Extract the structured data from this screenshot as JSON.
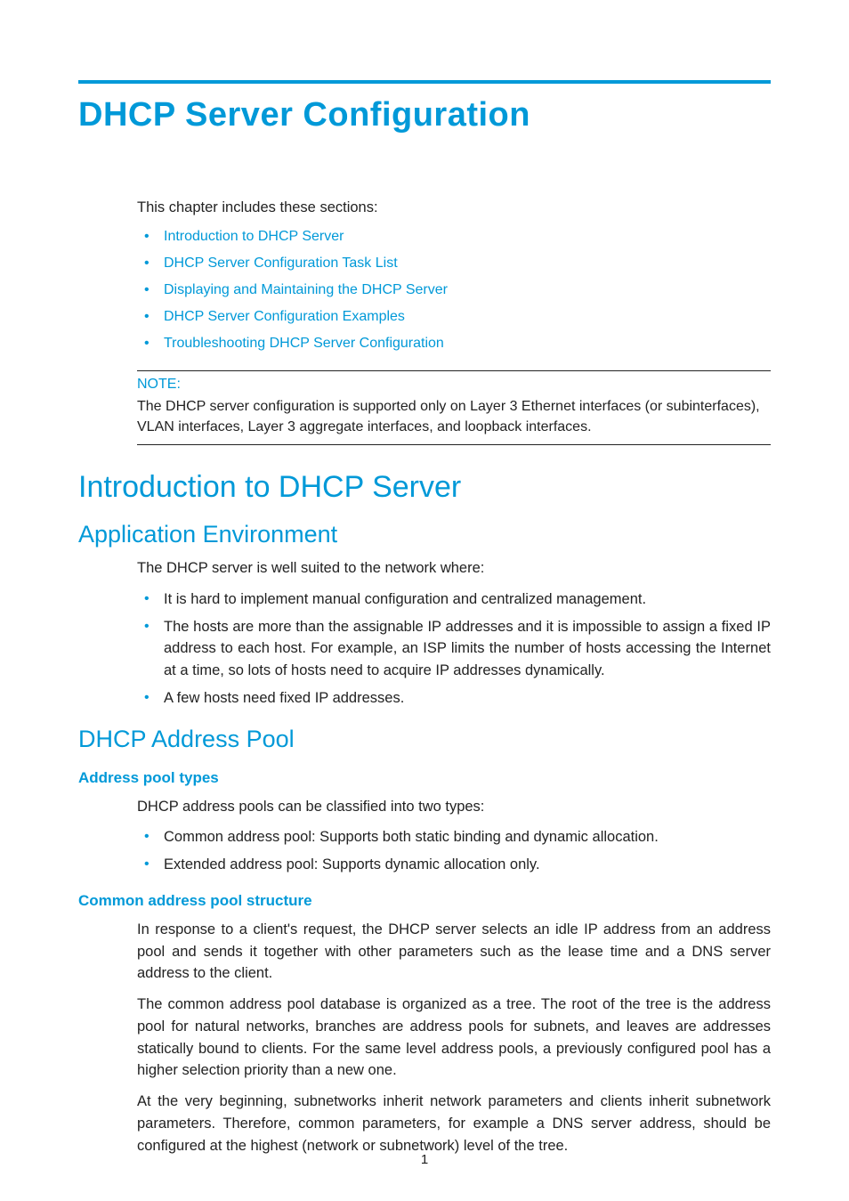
{
  "title": "DHCP Server Configuration",
  "intro": "This chapter includes these sections:",
  "toc": [
    "Introduction to DHCP Server",
    "DHCP Server Configuration Task List",
    "Displaying and Maintaining the DHCP Server",
    "DHCP Server Configuration Examples",
    "Troubleshooting DHCP Server Configuration"
  ],
  "note": {
    "label": "NOTE:",
    "body": "The DHCP server configuration is supported only on Layer 3 Ethernet interfaces (or subinterfaces), VLAN interfaces, Layer 3 aggregate interfaces, and loopback interfaces."
  },
  "s1": {
    "heading": "Introduction to DHCP Server",
    "sub1": {
      "heading": "Application Environment",
      "lead": "The DHCP server is well suited to the network where:",
      "items": [
        "It is hard to implement manual configuration and centralized management.",
        "The hosts are more than the assignable IP addresses and it is impossible to assign a fixed IP address to each host. For example, an ISP limits the number of hosts accessing the Internet at a time, so lots of hosts need to acquire IP addresses dynamically.",
        "A few hosts need fixed IP addresses."
      ]
    },
    "sub2": {
      "heading": "DHCP Address Pool",
      "part1": {
        "heading": "Address pool types",
        "lead": "DHCP address pools can be classified into two types:",
        "items": [
          "Common address pool: Supports both static binding and dynamic allocation.",
          "Extended address pool: Supports dynamic allocation only."
        ]
      },
      "part2": {
        "heading": "Common address pool structure",
        "p1": "In response to a client's request, the DHCP server selects an idle IP address from an address pool and sends it together with other parameters such as the lease time and a DNS server address to the client.",
        "p2": "The common address pool database is organized as a tree. The root of the tree is the address pool for natural networks, branches are address pools for subnets, and leaves are addresses statically bound to clients. For the same level address pools, a previously configured pool has a higher selection priority than a new one.",
        "p3": "At the very beginning, subnetworks inherit network parameters and clients inherit subnetwork parameters. Therefore, common parameters, for example a DNS server address, should be configured at the highest (network or subnetwork) level of the tree."
      }
    }
  },
  "page_number": "1"
}
